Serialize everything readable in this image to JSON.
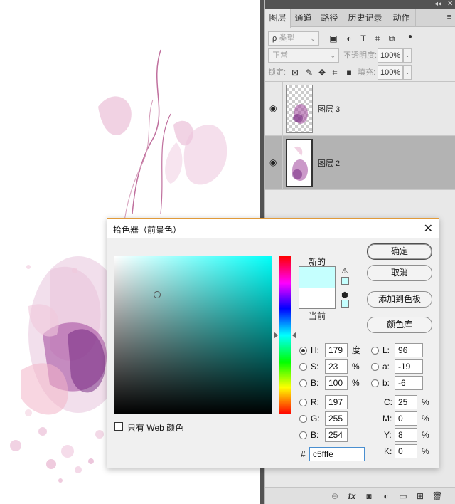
{
  "panel": {
    "topbar_collapse": "◂◂",
    "topbar_close": "✕",
    "tabs": [
      {
        "label": "图层"
      },
      {
        "label": "通道"
      },
      {
        "label": "路径"
      },
      {
        "label": "历史记录"
      },
      {
        "label": "动作"
      }
    ],
    "tab_menu": "≡",
    "filter": {
      "prefix": "ρ",
      "value": "类型",
      "arrow": "⌄"
    },
    "blend_mode": "正常",
    "opacity_label": "不透明度:",
    "opacity_value": "100%",
    "lock_label": "锁定:",
    "fill_label": "填充:",
    "fill_value": "100%",
    "layers": [
      {
        "name": "图层 3",
        "visible": true,
        "selected": false
      },
      {
        "name": "图层 2",
        "visible": true,
        "selected": true
      }
    ]
  },
  "dialog": {
    "title": "拾色器（前景色）",
    "new_label": "新的",
    "current_label": "当前",
    "new_color": "#c5fffe",
    "current_color": "#ffffff",
    "buttons": {
      "ok": "确定",
      "cancel": "取消",
      "add_swatches": "添加到色板",
      "color_libraries": "颜色库"
    },
    "web_only_label": "只有 Web 颜色",
    "hsb": {
      "h_label": "H:",
      "h_value": "179",
      "h_unit": "度",
      "s_label": "S:",
      "s_value": "23",
      "s_unit": "%",
      "b_label": "B:",
      "b_value": "100",
      "b_unit": "%"
    },
    "rgb": {
      "r_label": "R:",
      "r_value": "197",
      "g_label": "G:",
      "g_value": "255",
      "b_label": "B:",
      "b_value": "254"
    },
    "lab": {
      "l_label": "L:",
      "l_value": "96",
      "a_label": "a:",
      "a_value": "-19",
      "b_label": "b:",
      "b_value": "-6"
    },
    "cmyk": {
      "c_label": "C:",
      "c_value": "25",
      "c_unit": "%",
      "m_label": "M:",
      "m_value": "0",
      "m_unit": "%",
      "y_label": "Y:",
      "y_value": "8",
      "y_unit": "%",
      "k_label": "K:",
      "k_value": "0",
      "k_unit": "%"
    },
    "hex_label": "#",
    "hex_value": "c5fffe"
  }
}
